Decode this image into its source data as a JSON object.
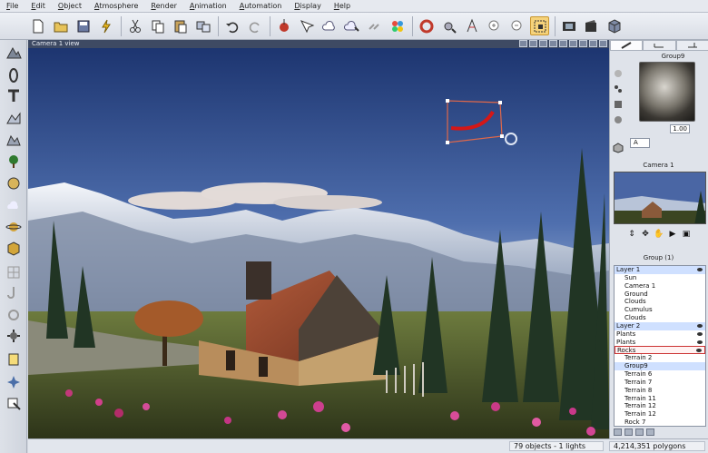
{
  "menu": [
    "File",
    "Edit",
    "Object",
    "Atmosphere",
    "Render",
    "Animation",
    "Automation",
    "Display",
    "Help"
  ],
  "toolbar_icons": [
    "new-document-icon",
    "open-folder-icon",
    "save-icon",
    "render-lightning-icon",
    "copy-icon",
    "cut-icon",
    "paste-icon",
    "duplicate-icon",
    "undo-icon",
    "redo-icon",
    "add-object-icon",
    "select-arrow-icon",
    "cloud-icon",
    "edit-cloud-icon",
    "link-icon",
    "material-spheres-icon",
    "torus-icon",
    "camera-focus-icon",
    "compass-icon",
    "zoom-in-icon",
    "zoom-out-icon",
    "frame-select-icon",
    "film-icon",
    "film-render-icon",
    "render-cube-icon"
  ],
  "left_tools": [
    "mountain-icon",
    "ring-icon",
    "text-icon",
    "terrain-icon",
    "rocks-icon",
    "tree-icon",
    "sphere-shade-icon",
    "cloud-layer-icon",
    "planet-icon",
    "cube-icon",
    "grid-icon",
    "hook-icon",
    "torus-small-icon",
    "gear-icon",
    "paper-icon",
    "bird-icon",
    "export-icon"
  ],
  "viewport": {
    "title": "Camera 1 view"
  },
  "right_panel": {
    "tabs": [
      "aspect-tab",
      "tools-tab",
      "library-tab"
    ],
    "object_title": "Group9",
    "scale_value": "1.00",
    "a_label": "A",
    "camera_title": "Camera 1",
    "group_title": "Group (1)",
    "tree": [
      {
        "label": "Layer 1",
        "indent": 0,
        "cls": "blue",
        "eye": true
      },
      {
        "label": "Sun",
        "indent": 1,
        "cls": "",
        "eye": false
      },
      {
        "label": "Camera 1",
        "indent": 1,
        "cls": "",
        "eye": false
      },
      {
        "label": "Ground",
        "indent": 1,
        "cls": "",
        "eye": false
      },
      {
        "label": "Clouds",
        "indent": 1,
        "cls": "",
        "eye": false
      },
      {
        "label": "Cumulus",
        "indent": 1,
        "cls": "",
        "eye": false
      },
      {
        "label": "Clouds",
        "indent": 1,
        "cls": "",
        "eye": false
      },
      {
        "label": "Layer 2",
        "indent": 0,
        "cls": "blue",
        "eye": true
      },
      {
        "label": "Plants",
        "indent": 0,
        "cls": "",
        "eye": true
      },
      {
        "label": "Plants",
        "indent": 0,
        "cls": "",
        "eye": true
      },
      {
        "label": "Rocks",
        "indent": 0,
        "cls": "sel",
        "eye": true
      },
      {
        "label": "Terrain 2",
        "indent": 1,
        "cls": "",
        "eye": false
      },
      {
        "label": "Group9",
        "indent": 1,
        "cls": "blue",
        "eye": false
      },
      {
        "label": "Terrain 6",
        "indent": 1,
        "cls": "",
        "eye": false
      },
      {
        "label": "Terrain 7",
        "indent": 1,
        "cls": "",
        "eye": false
      },
      {
        "label": "Terrain 8",
        "indent": 1,
        "cls": "",
        "eye": false
      },
      {
        "label": "Terrain 11",
        "indent": 1,
        "cls": "",
        "eye": false
      },
      {
        "label": "Terrain 12",
        "indent": 1,
        "cls": "",
        "eye": false
      },
      {
        "label": "Terrain 12",
        "indent": 1,
        "cls": "",
        "eye": false
      },
      {
        "label": "Rock 7",
        "indent": 1,
        "cls": "",
        "eye": false
      }
    ]
  },
  "status": {
    "objects": "79 objects - 1 lights",
    "polygons": "4,214,351 polygons"
  },
  "colors": {
    "accent": "#f5d27a",
    "selection": "#cc3333",
    "sky_top": "#20397a",
    "title_bar": "#3e4a63"
  }
}
